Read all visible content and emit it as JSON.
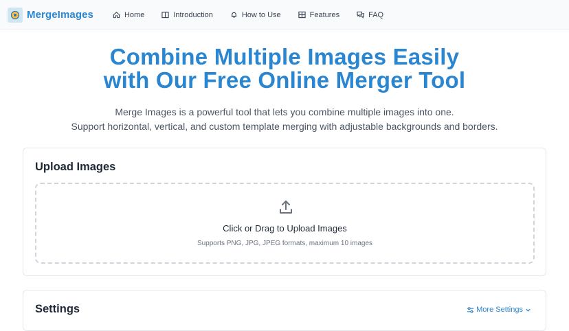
{
  "nav": {
    "brand": "MergeImages",
    "items": [
      {
        "label": "Home",
        "icon": "home-icon"
      },
      {
        "label": "Introduction",
        "icon": "book-icon"
      },
      {
        "label": "How to Use",
        "icon": "bell-icon"
      },
      {
        "label": "Features",
        "icon": "grid-icon"
      },
      {
        "label": "FAQ",
        "icon": "chat-icon"
      }
    ]
  },
  "hero": {
    "title_line1": "Combine Multiple Images Easily",
    "title_line2": "with Our Free Online Merger Tool",
    "subtitle_line1": "Merge Images is a powerful tool that lets you combine multiple images into one.",
    "subtitle_line2": "Support horizontal, vertical, and custom template merging with adjustable backgrounds and borders."
  },
  "upload": {
    "title": "Upload Images",
    "drop_title": "Click or Drag to Upload Images",
    "drop_hint": "Supports PNG, JPG, JPEG formats, maximum 10 images",
    "icon": "upload-icon"
  },
  "settings": {
    "title": "Settings",
    "more_label": "More Settings",
    "icon": "sliders-icon"
  },
  "colors": {
    "accent": "#2a86d1",
    "nav_bg": "#f9fafb",
    "border": "#e5e7eb"
  }
}
